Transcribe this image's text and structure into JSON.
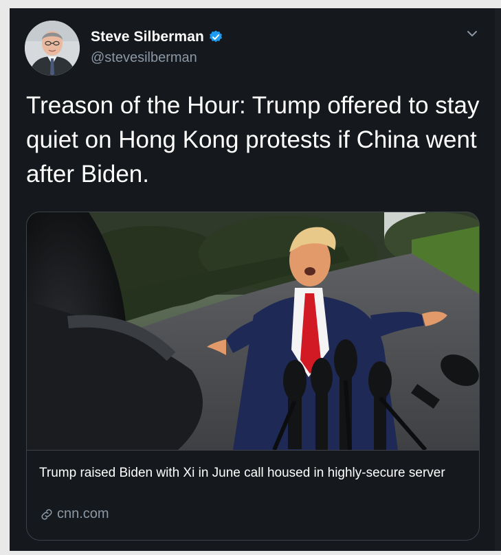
{
  "tweet": {
    "author": {
      "name": "Steve Silberman",
      "handle": "@stevesilberman",
      "verified": true
    },
    "text": "Treason of the Hour: Trump offered to stay quiet on Hong Kong protests if China went after Biden.",
    "icons": {
      "verified": "verified-badge-icon",
      "menu": "chevron-down-icon",
      "link": "link-icon"
    },
    "card": {
      "title": "Trump raised Biden with Xi in June call housed in highly-secure server",
      "domain": "cnn.com"
    }
  },
  "colors": {
    "background": "#15181c",
    "text_primary": "#ffffff",
    "text_secondary": "#8b98a5",
    "accent": "#1d9bf0",
    "border": "#3d4349"
  }
}
